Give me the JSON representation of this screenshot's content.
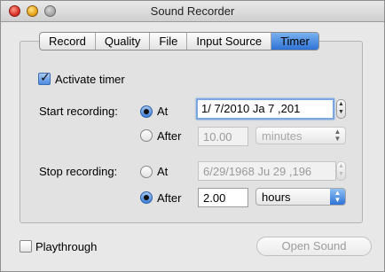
{
  "window": {
    "title": "Sound Recorder"
  },
  "tabs": [
    {
      "label": "Record"
    },
    {
      "label": "Quality"
    },
    {
      "label": "File"
    },
    {
      "label": "Input Source"
    },
    {
      "label": "Timer",
      "active": true
    }
  ],
  "timer": {
    "activate_label": "Activate timer",
    "activate_checked": true,
    "start": {
      "label": "Start recording:",
      "at_label": "At",
      "at_selected": true,
      "at_value": "1/  7/2010  Ja   7 ,201",
      "after_label": "After",
      "after_value": "10.00",
      "after_unit": "minutes"
    },
    "stop": {
      "label": "Stop recording:",
      "at_label": "At",
      "at_value": "6/29/1968  Ju 29 ,196",
      "after_label": "After",
      "after_selected": true,
      "after_value": "2.00",
      "after_unit": "hours"
    }
  },
  "footer": {
    "playthrough_label": "Playthrough",
    "playthrough_checked": false,
    "open_sound_label": "Open Sound"
  },
  "colors": {
    "accent": "#2f73d6"
  }
}
